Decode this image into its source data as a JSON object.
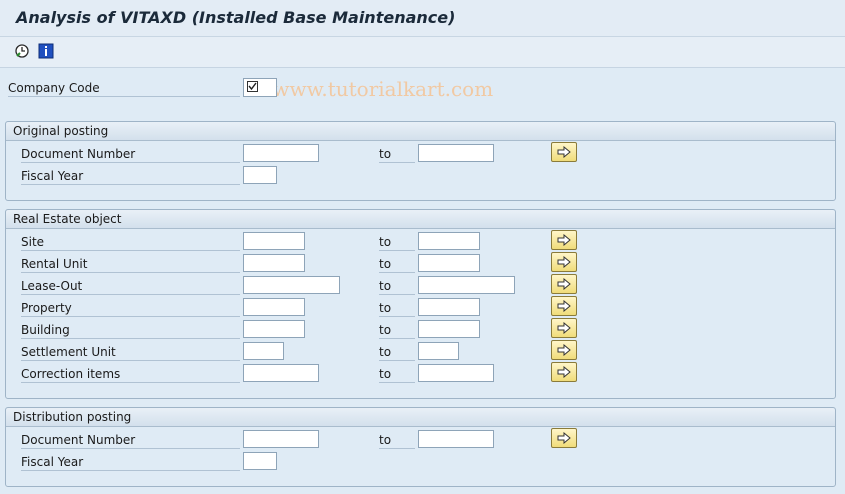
{
  "window": {
    "title": "Analysis of VITAXD (Installed Base Maintenance)"
  },
  "toolbar": {
    "execute_icon": "clock-execute-icon",
    "info_icon": "info-icon",
    "watermark": "© www.tutorialkart.com"
  },
  "company_code": {
    "label": "Company Code",
    "checked": true
  },
  "groups": {
    "original": {
      "title": "Original posting"
    },
    "real_estate": {
      "title": "Real Estate object"
    },
    "distribution": {
      "title": "Distribution posting"
    }
  },
  "labels": {
    "doc_number": "Document Number",
    "fiscal_year": "Fiscal Year",
    "site": "Site",
    "rental_unit": "Rental Unit",
    "lease_out": "Lease-Out",
    "property": "Property",
    "building": "Building",
    "settlement_unit": "Settlement Unit",
    "correction_items": "Correction items",
    "to": "to"
  },
  "colors": {
    "accent": "#dfebf5",
    "button": "#f0dc7a",
    "watermark": "#f1c9a3"
  }
}
